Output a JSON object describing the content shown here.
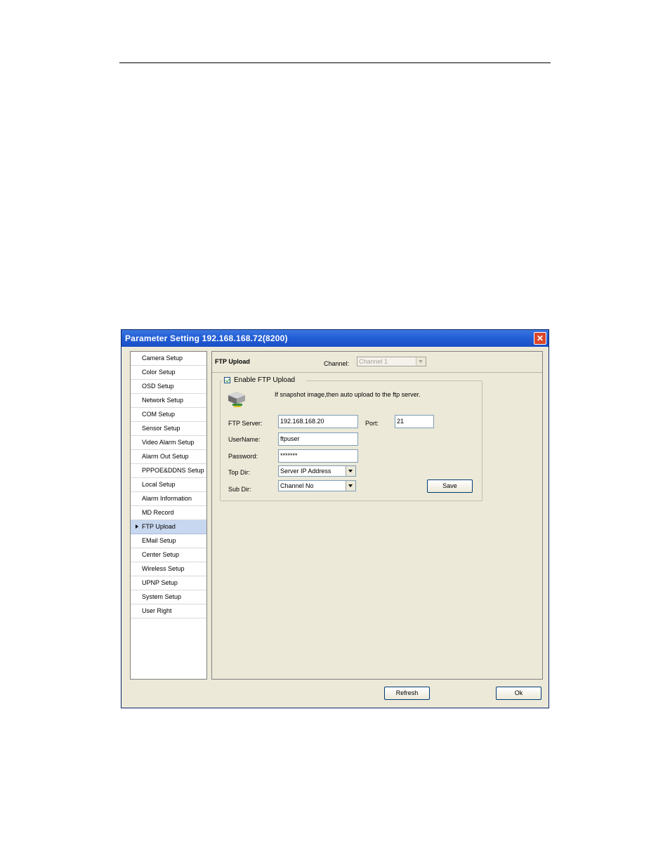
{
  "window": {
    "title": "Parameter Setting 192.168.168.72(8200)",
    "close_glyph": "✕"
  },
  "nav": {
    "items": [
      {
        "label": "Camera Setup"
      },
      {
        "label": "Color Setup"
      },
      {
        "label": "OSD Setup"
      },
      {
        "label": "Network Setup"
      },
      {
        "label": "COM Setup"
      },
      {
        "label": "Sensor Setup"
      },
      {
        "label": "Video Alarm Setup"
      },
      {
        "label": "Alarm Out Setup"
      },
      {
        "label": "PPPOE&DDNS Setup"
      },
      {
        "label": "Local Setup"
      },
      {
        "label": "Alarm Information"
      },
      {
        "label": "MD Record"
      },
      {
        "label": "FTP Upload",
        "active": true
      },
      {
        "label": "EMail Setup"
      },
      {
        "label": "Center Setup"
      },
      {
        "label": "Wireless Setup"
      },
      {
        "label": "UPNP Setup"
      },
      {
        "label": "System Setup"
      },
      {
        "label": "User Right"
      }
    ]
  },
  "panel": {
    "title": "FTP Upload",
    "channel_label": "Channel:",
    "channel_value": "Channel 1",
    "enable_label": "Enable FTP Upload",
    "enable_checked": true,
    "hint": "If snapshot image,then auto upload to the ftp server.",
    "ftp_server_label": "FTP Server:",
    "ftp_server_value": "192.168.168.20",
    "port_label": "Port:",
    "port_value": "21",
    "username_label": "UserName:",
    "username_value": "ftpuser",
    "password_label": "Password:",
    "password_value": "*******",
    "top_dir_label": "Top Dir:",
    "top_dir_value": "Server IP Address",
    "sub_dir_label": "Sub Dir:",
    "sub_dir_value": "Channel No",
    "save_label": "Save"
  },
  "footer": {
    "refresh_label": "Refresh",
    "ok_label": "Ok"
  },
  "icons": {
    "server": "server-drive-icon",
    "close": "close-icon",
    "dropdown": "chevron-down-icon"
  }
}
